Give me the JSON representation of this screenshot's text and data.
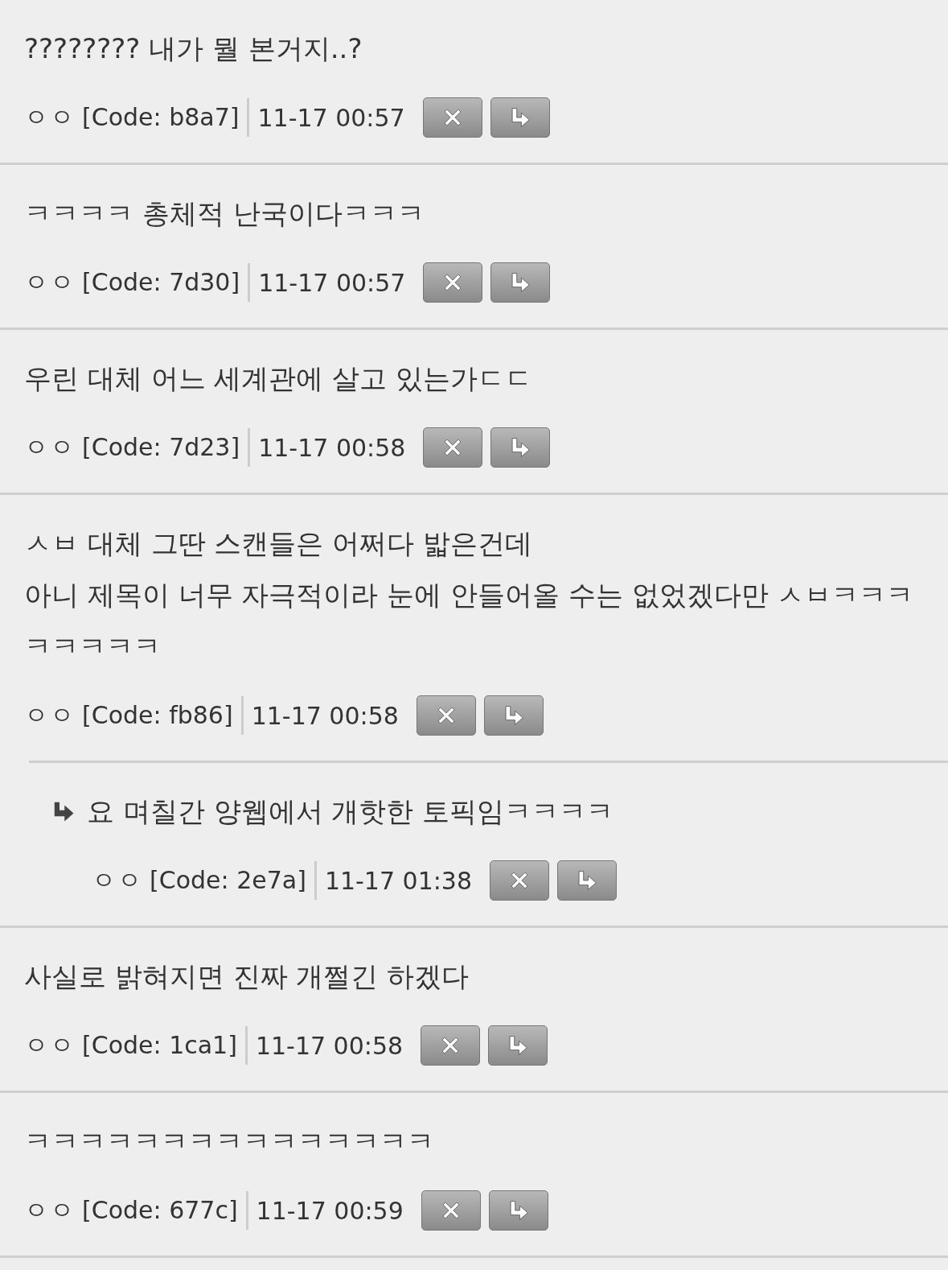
{
  "comments": [
    {
      "text": "???????? 내가 뭘 본거지..?",
      "author": "ㅇㅇ",
      "code": "[Code: b8a7]",
      "time": "11-17 00:57"
    },
    {
      "text": "ㅋㅋㅋㅋ 총체적 난국이다ㅋㅋㅋ",
      "author": "ㅇㅇ",
      "code": "[Code: 7d30]",
      "time": "11-17 00:57"
    },
    {
      "text": "우린 대체 어느 세계관에 살고 있는가ㄷㄷ",
      "author": "ㅇㅇ",
      "code": "[Code: 7d23]",
      "time": "11-17 00:58"
    },
    {
      "text": "ㅅㅂ 대체 그딴 스캔들은 어쩌다 밟은건데\n아니 제목이 너무 자극적이라 눈에 안들어올 수는 없었겠다만 ㅅㅂㅋㅋㅋㅋㅋㅋㅋㅋ",
      "author": "ㅇㅇ",
      "code": "[Code: fb86]",
      "time": "11-17 00:58",
      "children": [
        {
          "text": "요 며칠간 양웹에서 개핫한 토픽임ㅋㅋㅋㅋ",
          "author": "ㅇㅇ",
          "code": "[Code: 2e7a]",
          "time": "11-17 01:38"
        }
      ]
    },
    {
      "text": "사실로 밝혀지면 진짜 개쩔긴 하겠다",
      "author": "ㅇㅇ",
      "code": "[Code: 1ca1]",
      "time": "11-17 00:58"
    },
    {
      "text": "ㅋㅋㅋㅋㅋㅋㅋㅋㅋㅋㅋㅋㅋㅋㅋ",
      "author": "ㅇㅇ",
      "code": "[Code: 677c]",
      "time": "11-17 00:59"
    }
  ]
}
